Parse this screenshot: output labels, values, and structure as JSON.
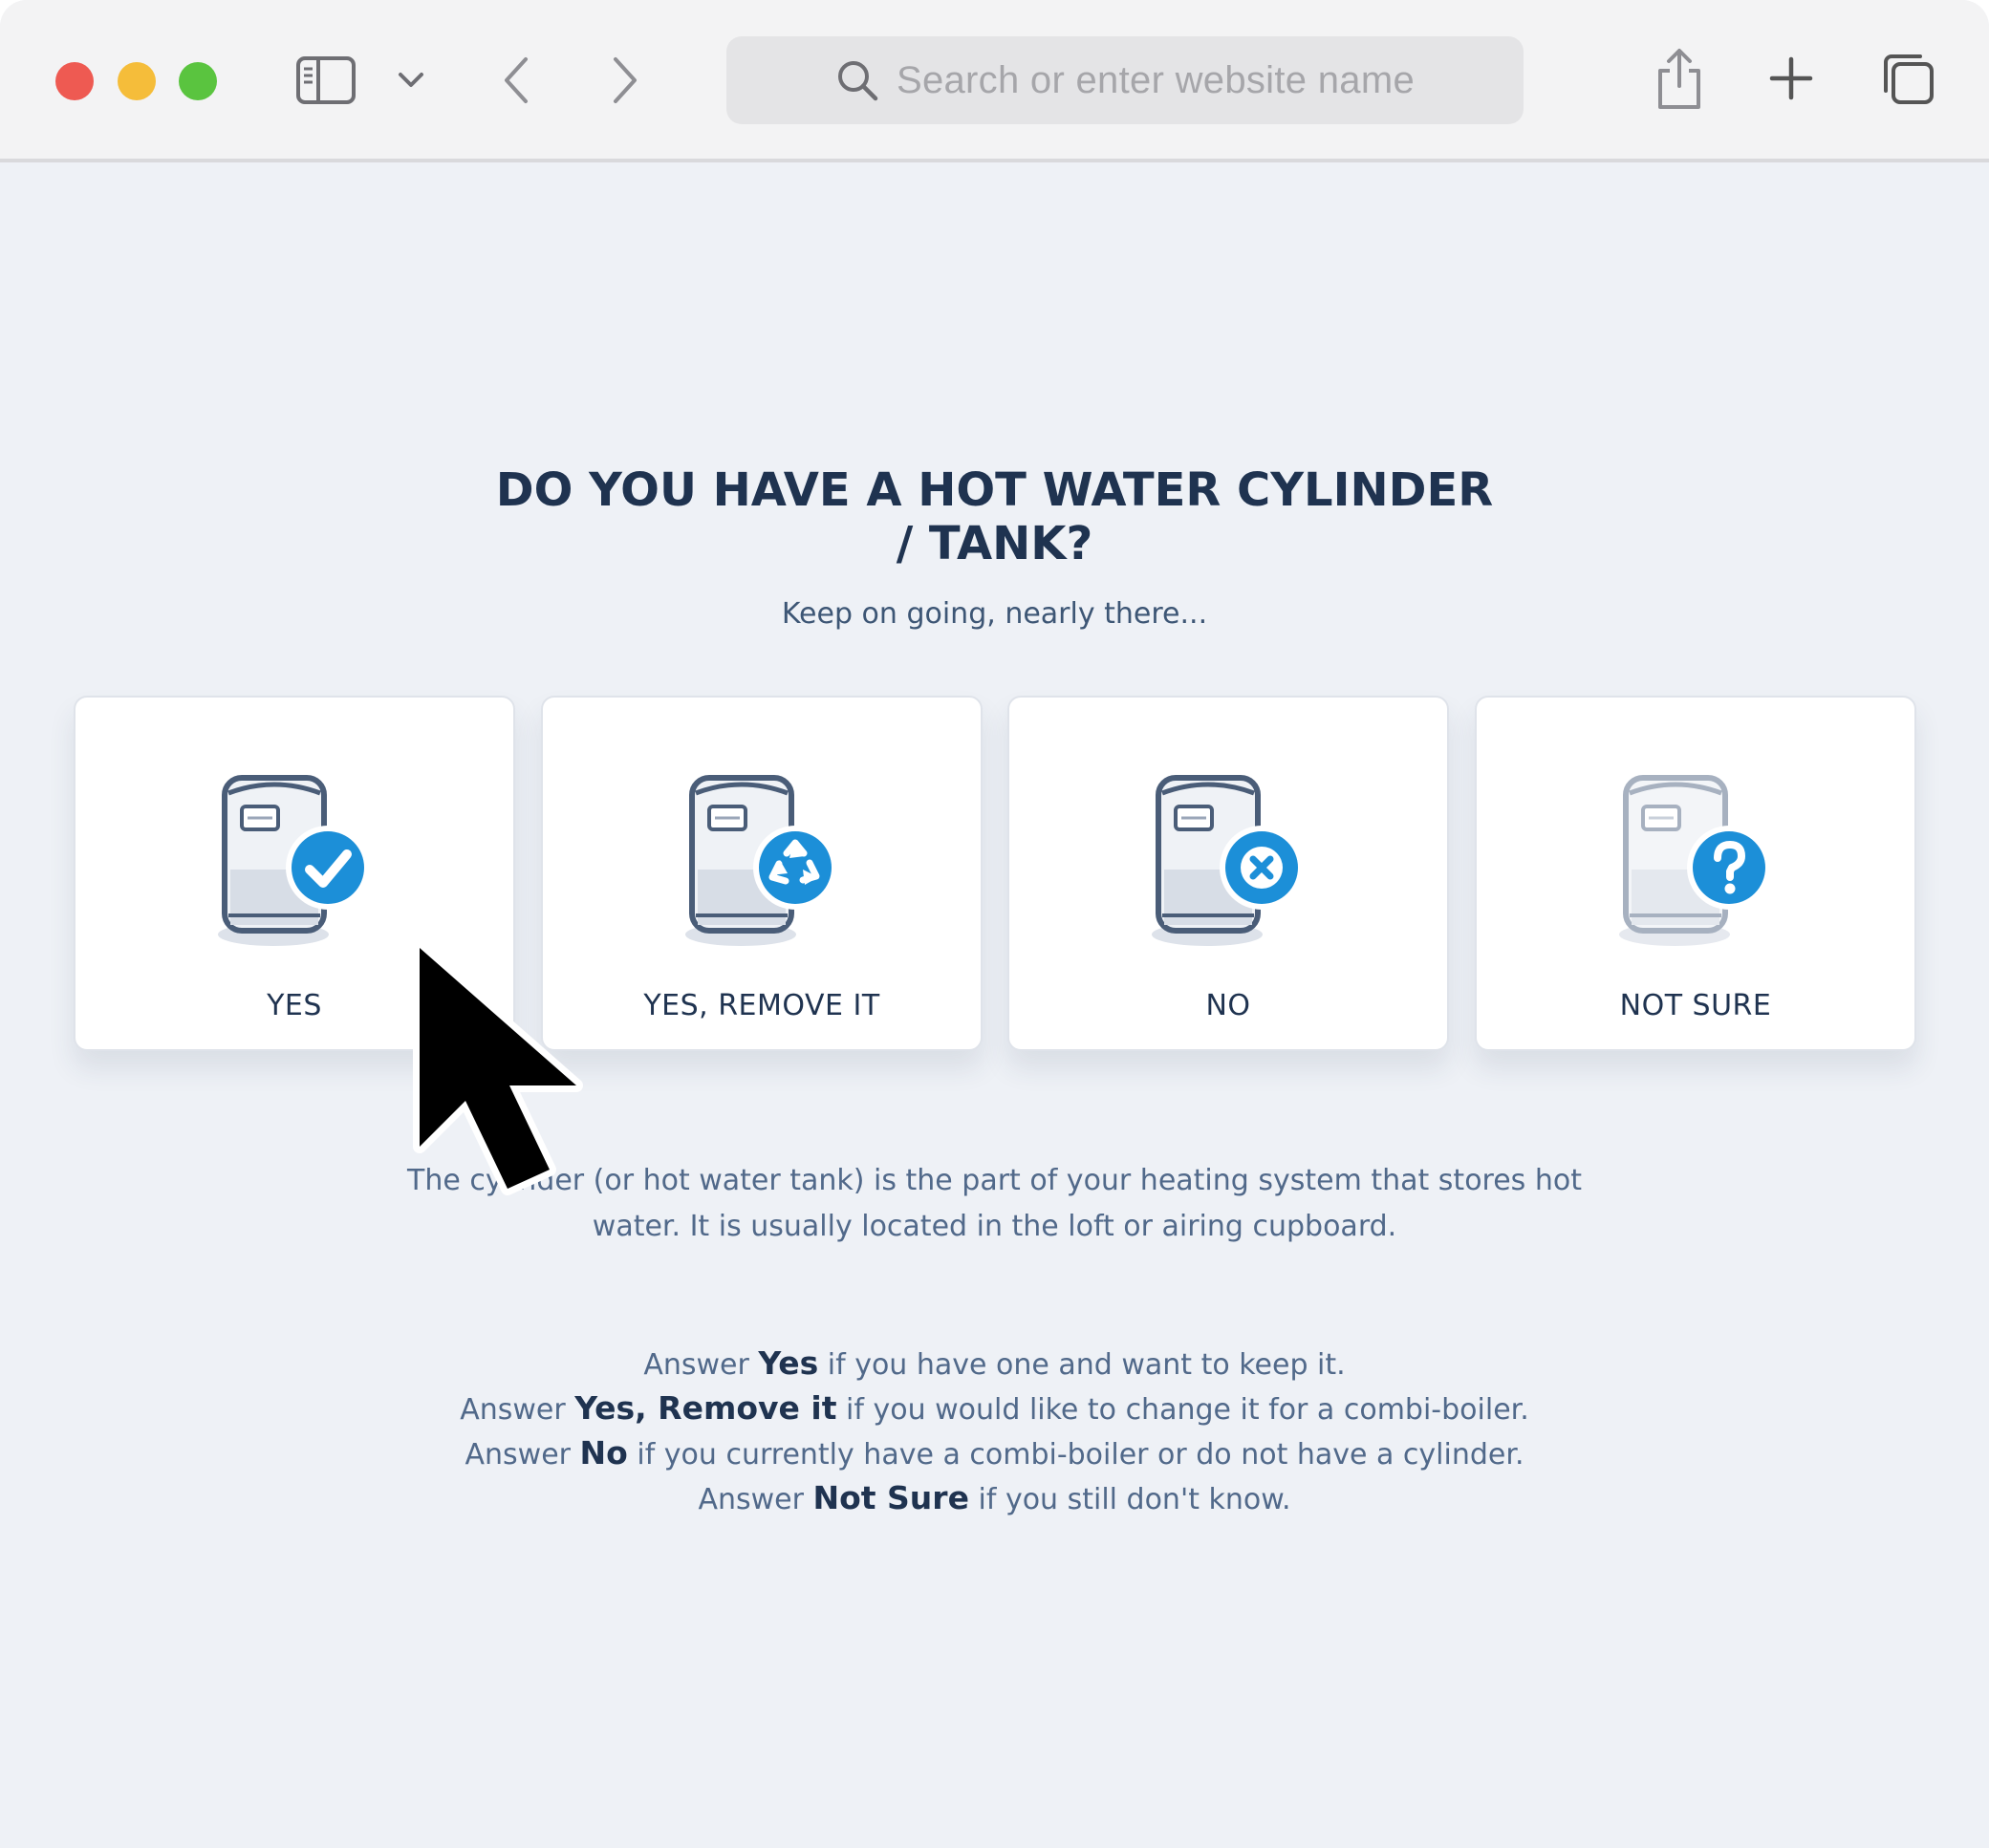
{
  "browser": {
    "address_placeholder": "Search or enter website name",
    "icons": [
      "close-window-icon",
      "minimize-window-icon",
      "zoom-window-icon",
      "sidebar-icon",
      "chevron-down-icon",
      "back-arrow-icon",
      "forward-arrow-icon",
      "search-icon",
      "share-icon",
      "new-tab-plus-icon",
      "tab-overview-icon"
    ]
  },
  "page": {
    "title_line1": "DO YOU HAVE A HOT WATER CYLINDER",
    "title_line2": "/ TANK?",
    "subtitle": "Keep on going, nearly there...",
    "options": [
      {
        "label": "YES",
        "icon": "cylinder-check-icon"
      },
      {
        "label": "YES, REMOVE IT",
        "icon": "cylinder-recycle-icon"
      },
      {
        "label": "NO",
        "icon": "cylinder-cross-icon"
      },
      {
        "label": "NOT SURE",
        "icon": "cylinder-question-icon"
      }
    ],
    "description_line1": "The cylinder (or hot water tank) is the part of your heating system that stores hot",
    "description_line2": "water. It is usually located in the loft or airing cupboard.",
    "answers": [
      {
        "prefix": "Answer ",
        "bold": "Yes",
        "suffix": " if you have one and want to keep it."
      },
      {
        "prefix": "Answer ",
        "bold": "Yes, Remove it",
        "suffix": " if you would like to change it for a combi-boiler."
      },
      {
        "prefix": "Answer ",
        "bold": "No",
        "suffix": " if you currently have a combi-boiler or do not have a cylinder."
      },
      {
        "prefix": "Answer ",
        "bold": "Not Sure",
        "suffix": " if you still don't know."
      }
    ]
  },
  "colors": {
    "accent_blue": "#1c8fd8",
    "title_navy": "#1f3350",
    "background": "#eef1f6"
  }
}
